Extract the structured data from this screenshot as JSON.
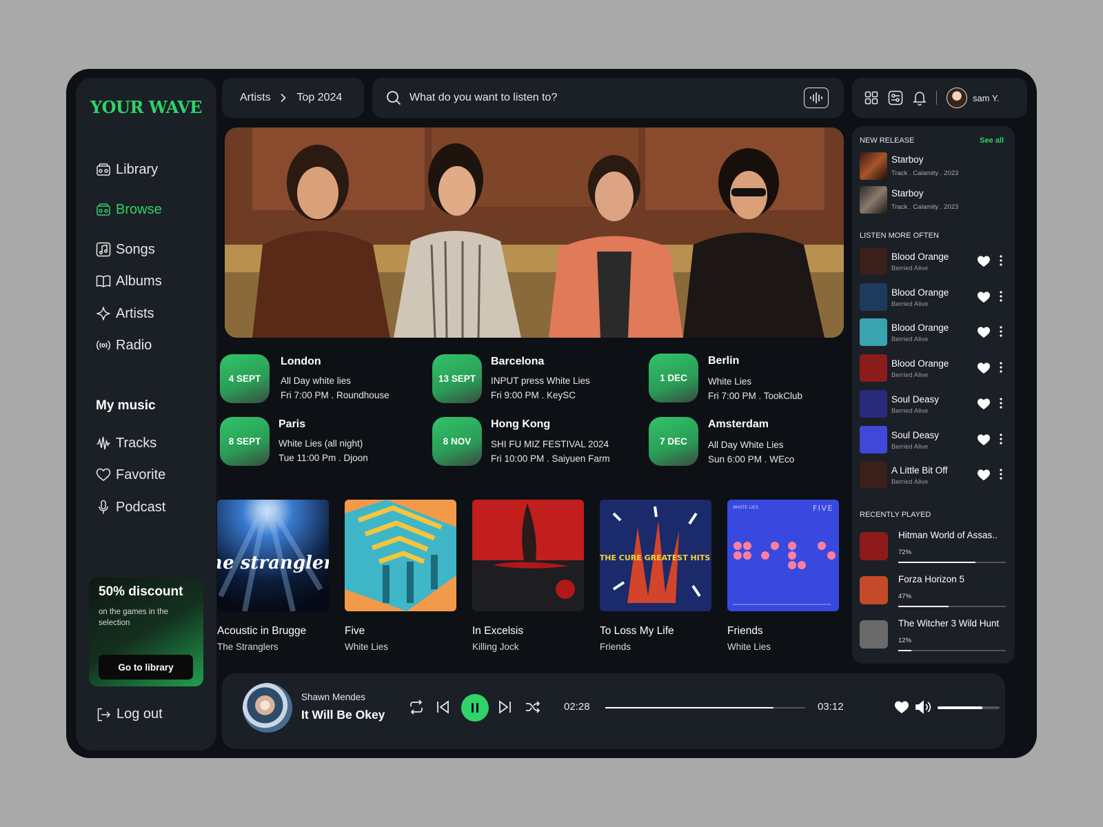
{
  "app": {
    "logo": "YOUR WAVE"
  },
  "sidebar": {
    "nav": [
      {
        "label": "Library",
        "icon": "radio-box-icon"
      },
      {
        "label": "Browse",
        "icon": "radio-box-icon",
        "active": true
      },
      {
        "label": "Songs",
        "icon": "music-note-icon"
      },
      {
        "label": "Albums",
        "icon": "book-icon"
      },
      {
        "label": "Artists",
        "icon": "sparkle-icon"
      },
      {
        "label": "Radio",
        "icon": "broadcast-icon"
      }
    ],
    "my_music_title": "My music",
    "my_music": [
      {
        "label": "Tracks",
        "icon": "waveform-icon"
      },
      {
        "label": "Favorite",
        "icon": "heart-icon"
      },
      {
        "label": "Podcast",
        "icon": "microphone-icon"
      }
    ],
    "promo": {
      "title": "50% discount",
      "text": "on the games in the selection",
      "button": "Go to library"
    },
    "logout": "Log out"
  },
  "breadcrumb": {
    "first": "Artists",
    "second": "Top 2024"
  },
  "search": {
    "placeholder": "What do you want to listen to?"
  },
  "user": {
    "name": "sam Y."
  },
  "events": [
    {
      "date": "4 SEPT",
      "city": "London",
      "line1": "All Day  white lies",
      "line2": "Fri 7:00 PM  .  Roundhouse"
    },
    {
      "date": "13 SEPT",
      "city": "Barcelona",
      "line1": "INPUT press White Lies",
      "line2": "Fri 9:00  PM  .  KeySC"
    },
    {
      "date": "1 DEC",
      "city": "Berlin",
      "line1": "White Lies",
      "line2": "Fri 7:00 PM  .  TookClub"
    },
    {
      "date": "8 SEPT",
      "city": "Paris",
      "line1": "White Lies  (all night)",
      "line2": "Tue 11:00 Pm  .  Djoon"
    },
    {
      "date": "8 NOV",
      "city": "Hong Kong",
      "line1": "SHI FU MIZ FESTIVAL 2024",
      "line2": "Fri 10:00  PM . Saiyuen Farm"
    },
    {
      "date": "7 DEC",
      "city": "Amsterdam",
      "line1": "All Day White Lies",
      "line2": "Sun 6:00 PM  .  WEco"
    }
  ],
  "albums": [
    {
      "title": "Acoustic in Brugge",
      "artist": "The Stranglers",
      "cover_text": "the stranglers"
    },
    {
      "title": "Five",
      "artist": "White Lies"
    },
    {
      "title": "In Excelsis",
      "artist": "Killing Jock"
    },
    {
      "title": "To Loss My Life",
      "artist": "Friends",
      "cover_text": "THE CURE GREATEST HITS"
    },
    {
      "title": "Friends",
      "artist": "White Lies",
      "cover_text_left": "WHITE LIES",
      "cover_text_right": "FIVE"
    }
  ],
  "right": {
    "new_release_title": "NEW RELEASE",
    "see_all": "See all",
    "new_release": [
      {
        "title": "Starboy",
        "meta": "Track  .  Calamity  .  2023"
      },
      {
        "title": "Starboy",
        "meta": "Track  .  Calamity  .  2023"
      }
    ],
    "listen_title": "LISTEN MORE OFTEN",
    "listen": [
      {
        "title": "Blood Orange",
        "sub": "Berried Alive",
        "color": "#3a1f1a"
      },
      {
        "title": "Blood Orange",
        "sub": "Berried Alive",
        "color": "#1e3b5e"
      },
      {
        "title": "Blood Orange",
        "sub": "Berried Alive",
        "color": "#3aa3b0"
      },
      {
        "title": "Blood Orange",
        "sub": "Berried Alive",
        "color": "#8b1c1c"
      },
      {
        "title": "Soul Deasy",
        "sub": "Berried Alive",
        "color": "#2a2a7a"
      },
      {
        "title": "Soul Deasy",
        "sub": "Berried Alive",
        "color": "#3f48d8"
      },
      {
        "title": "A Little Bit Off",
        "sub": "Berried Alive",
        "color": "#3a1f1a"
      }
    ],
    "recent_title": "RECENTLY PLAYED",
    "recent": [
      {
        "title": "Hitman World of Assas..",
        "pct": "72%",
        "progress": 0.72,
        "color": "#8d1a1a"
      },
      {
        "title": "Forza Horizon 5",
        "pct": "47%",
        "progress": 0.47,
        "color": "#c44a2a"
      },
      {
        "title": "The Witcher 3 Wild Hunt",
        "pct": "12%",
        "progress": 0.12,
        "color": "#6a6a6a"
      }
    ]
  },
  "player": {
    "artist": "Shawn Mendes",
    "song": "It Will Be Okey",
    "time_now": "02:28",
    "time_total": "03:12",
    "progress": 0.84,
    "volume": 0.72
  },
  "colors": {
    "accent": "#2fd36a",
    "panel": "#1b1f26",
    "background": "#0d1015"
  }
}
